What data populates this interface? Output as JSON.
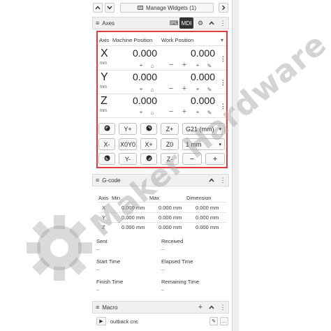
{
  "toolbar": {
    "up_icon": "chevron-up-icon",
    "down_icon": "chevron-down-icon",
    "manage_label": "Manage Widgets (1)",
    "next_icon": "chevron-right-icon"
  },
  "axes_widget": {
    "title": "Axes",
    "mdi_label": "MDI",
    "columns": [
      "Axis",
      "Machine Position",
      "Work Position"
    ],
    "rows": [
      {
        "axis": "X",
        "unit": "mm",
        "machine": "0.000",
        "work": "0.000"
      },
      {
        "axis": "Y",
        "unit": "mm",
        "machine": "0.000",
        "work": "0.000"
      },
      {
        "axis": "Z",
        "unit": "mm",
        "machine": "0.000",
        "work": "0.000"
      }
    ],
    "jog": {
      "row1": [
        "",
        "Y+",
        "",
        "Z+",
        "G21 (mm)"
      ],
      "row2": [
        "X-",
        "X0Y0",
        "X+",
        "Z0",
        "1 mm"
      ],
      "row3": [
        "",
        "Y-",
        "",
        "Z-",
        "−",
        "+"
      ]
    }
  },
  "gcode_widget": {
    "title": "G-code",
    "columns": [
      "Axis",
      "Min",
      "Max",
      "Dimension"
    ],
    "rows": [
      {
        "axis": "X",
        "min": "0.000 mm",
        "max": "0.000 mm",
        "dim": "0.000 mm"
      },
      {
        "axis": "Y",
        "min": "0.000 mm",
        "max": "0.000 mm",
        "dim": "0.000 mm"
      },
      {
        "axis": "Z",
        "min": "0.000 mm",
        "max": "0.000 mm",
        "dim": "0.000 mm"
      }
    ],
    "stats": [
      {
        "label": "Sent",
        "value": "–"
      },
      {
        "label": "Received",
        "value": "–"
      },
      {
        "label": "Start Time",
        "value": "–"
      },
      {
        "label": "Elapsed Time",
        "value": "–"
      },
      {
        "label": "Finish Time",
        "value": "–"
      },
      {
        "label": "Remaining Time",
        "value": "–"
      }
    ]
  },
  "macro_widget": {
    "title": "Macro",
    "items": [
      {
        "name": "outback cnc"
      }
    ]
  },
  "watermark": "Maker Hardware",
  "colors": {
    "highlight_border": "#e03a3a",
    "header_bg": "#f0f0f0",
    "mdi_bg": "#333333"
  }
}
